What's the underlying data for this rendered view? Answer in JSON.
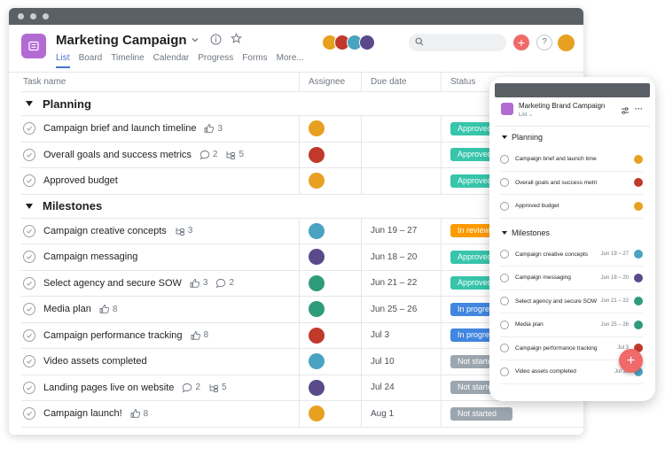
{
  "project": {
    "title": "Marketing Campaign",
    "tabs": [
      "List",
      "Board",
      "Timeline",
      "Calendar",
      "Progress",
      "Forms",
      "More..."
    ],
    "active_tab": "List"
  },
  "columns": {
    "task_name": "Task name",
    "assignee": "Assignee",
    "due_date": "Due date",
    "status": "Status"
  },
  "sections": [
    {
      "title": "Planning",
      "tasks": [
        {
          "name": "Campaign brief and launch timeline",
          "likes": "3",
          "comments": "",
          "subtasks": "",
          "avatar": "#e8a020",
          "due": "",
          "status": "Approved",
          "status_color": "#37c5ab"
        },
        {
          "name": "Overall goals and success metrics",
          "likes": "",
          "comments": "2",
          "subtasks": "5",
          "avatar": "#c0392b",
          "due": "",
          "status": "Approved",
          "status_color": "#37c5ab"
        },
        {
          "name": "Approved budget",
          "likes": "",
          "comments": "",
          "subtasks": "",
          "avatar": "#e8a020",
          "due": "",
          "status": "Approved",
          "status_color": "#37c5ab"
        }
      ]
    },
    {
      "title": "Milestones",
      "tasks": [
        {
          "name": "Campaign creative concepts",
          "likes": "",
          "comments": "",
          "subtasks": "3",
          "avatar": "#4aa3c0",
          "due": "Jun 19 – 27",
          "status": "In review",
          "status_color": "#fd9a00"
        },
        {
          "name": "Campaign messaging",
          "likes": "",
          "comments": "",
          "subtasks": "",
          "avatar": "#5a4a8a",
          "due": "Jun 18 – 20",
          "status": "Approved",
          "status_color": "#37c5ab"
        },
        {
          "name": "Select agency and secure SOW",
          "likes": "3",
          "comments": "2",
          "subtasks": "",
          "avatar": "#2e9c7a",
          "due": "Jun 21 – 22",
          "status": "Approved",
          "status_color": "#37c5ab"
        },
        {
          "name": "Media plan",
          "likes": "8",
          "comments": "",
          "subtasks": "",
          "avatar": "#2e9c7a",
          "due": "Jun 25 – 26",
          "status": "In progress",
          "status_color": "#4186e0"
        },
        {
          "name": "Campaign performance tracking",
          "likes": "8",
          "comments": "",
          "subtasks": "",
          "avatar": "#c0392b",
          "due": "Jul 3",
          "status": "In progress",
          "status_color": "#4186e0"
        },
        {
          "name": "Video assets completed",
          "likes": "",
          "comments": "",
          "subtasks": "",
          "avatar": "#4aa3c0",
          "due": "Jul 10",
          "status": "Not started",
          "status_color": "#9ca6af"
        },
        {
          "name": "Landing pages live on website",
          "likes": "",
          "comments": "2",
          "subtasks": "5",
          "avatar": "#5a4a8a",
          "due": "Jul 24",
          "status": "Not started",
          "status_color": "#9ca6af"
        },
        {
          "name": "Campaign launch!",
          "likes": "8",
          "comments": "",
          "subtasks": "",
          "avatar": "#e8a020",
          "due": "Aug 1",
          "status": "Not started",
          "status_color": "#9ca6af"
        }
      ]
    }
  ],
  "mobile": {
    "title": "Marketing Brand Campaign",
    "view": "List",
    "sections": [
      {
        "title": "Planning",
        "tasks": [
          {
            "name": "Campaign brief and launch timeline",
            "due": "",
            "avatar": "#e8a020"
          },
          {
            "name": "Overall goals and success metrics",
            "due": "",
            "avatar": "#c0392b"
          },
          {
            "name": "Approved budget",
            "due": "",
            "avatar": "#e8a020"
          }
        ]
      },
      {
        "title": "Milestones",
        "tasks": [
          {
            "name": "Campaign creative concepts",
            "due": "Jun 19 – 27",
            "avatar": "#4aa3c0"
          },
          {
            "name": "Campaign messaging",
            "due": "Jun 18 – 20",
            "avatar": "#5a4a8a"
          },
          {
            "name": "Select agency and secure SOW",
            "due": "Jun 21 – 22",
            "avatar": "#2e9c7a"
          },
          {
            "name": "Media plan",
            "due": "Jun 25 – 26",
            "avatar": "#2e9c7a"
          },
          {
            "name": "Campaign performance tracking",
            "due": "Jul 3",
            "avatar": "#c0392b"
          },
          {
            "name": "Video assets completed",
            "due": "Jul 10",
            "avatar": "#4aa3c0"
          }
        ]
      }
    ]
  },
  "colors": {
    "accent": "#4573d2",
    "project_icon": "#b36bd4",
    "add_button": "#f06a6a"
  },
  "header_avatars": [
    "#e8a020",
    "#c0392b",
    "#4aa3c0",
    "#5a4a8a"
  ]
}
